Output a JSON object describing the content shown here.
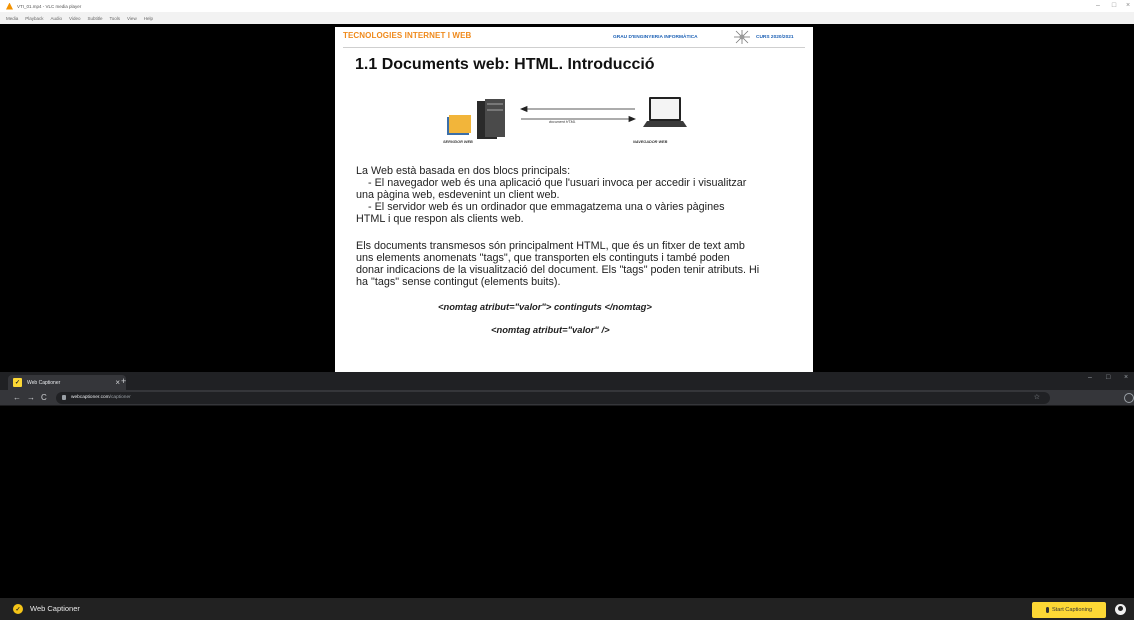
{
  "vlc": {
    "title": "VTI_01.mp4 - VLC media player",
    "menu": [
      "Media",
      "Playback",
      "Audio",
      "Video",
      "Subtitle",
      "Tools",
      "View",
      "Help"
    ],
    "controls": {
      "minimize": "–",
      "maximize": "□",
      "close": "×"
    }
  },
  "slide": {
    "course": "TECNOLOGIES INTERNET I WEB",
    "degree": "GRAU D'ENGINYERIA INFORMÀTICA",
    "year": "CURS 2020/2021",
    "title": "1.1 Documents web: HTML. Introducció",
    "diagram": {
      "server_label": "SERVIDOR WEB",
      "browser_label": "NAVEGADOR WEB",
      "arrow_label": "document HTML"
    },
    "paragraph1": [
      "La Web està basada en dos blocs principals:",
      "- El navegador web és una aplicació que l'usuari invoca per accedir i visualitzar",
      "una pàgina web, esdevenint un client web.",
      "- El servidor web és un ordinador que emmagatzema una o vàries pàgines",
      "HTML i que respon als clients web."
    ],
    "paragraph2": [
      "Els documents transmesos són principalment HTML, que és un fitxer de text amb",
      "uns elements anomenats \"tags\", que transporten els continguts i també poden",
      "donar indicacions de la visualització del document. Els \"tags\" poden tenir atributs. Hi",
      "ha \"tags\" sense contingut (elements buits)."
    ],
    "code1": "<nomtag atribut=\"valor\"> continguts </nomtag>",
    "code2": "<nomtag atribut=\"valor\" />"
  },
  "chrome": {
    "tab_title": "Web Captioner",
    "tab_close": "×",
    "new_tab": "+",
    "nav": {
      "back": "←",
      "forward": "→",
      "reload": "C"
    },
    "url_host": "webcaptioner.com",
    "url_path": "/captioner",
    "controls": {
      "minimize": "–",
      "maximize": "□",
      "close": "×"
    }
  },
  "captioner": {
    "app_name": "Web Captioner",
    "start_button": "Start Captioning"
  }
}
